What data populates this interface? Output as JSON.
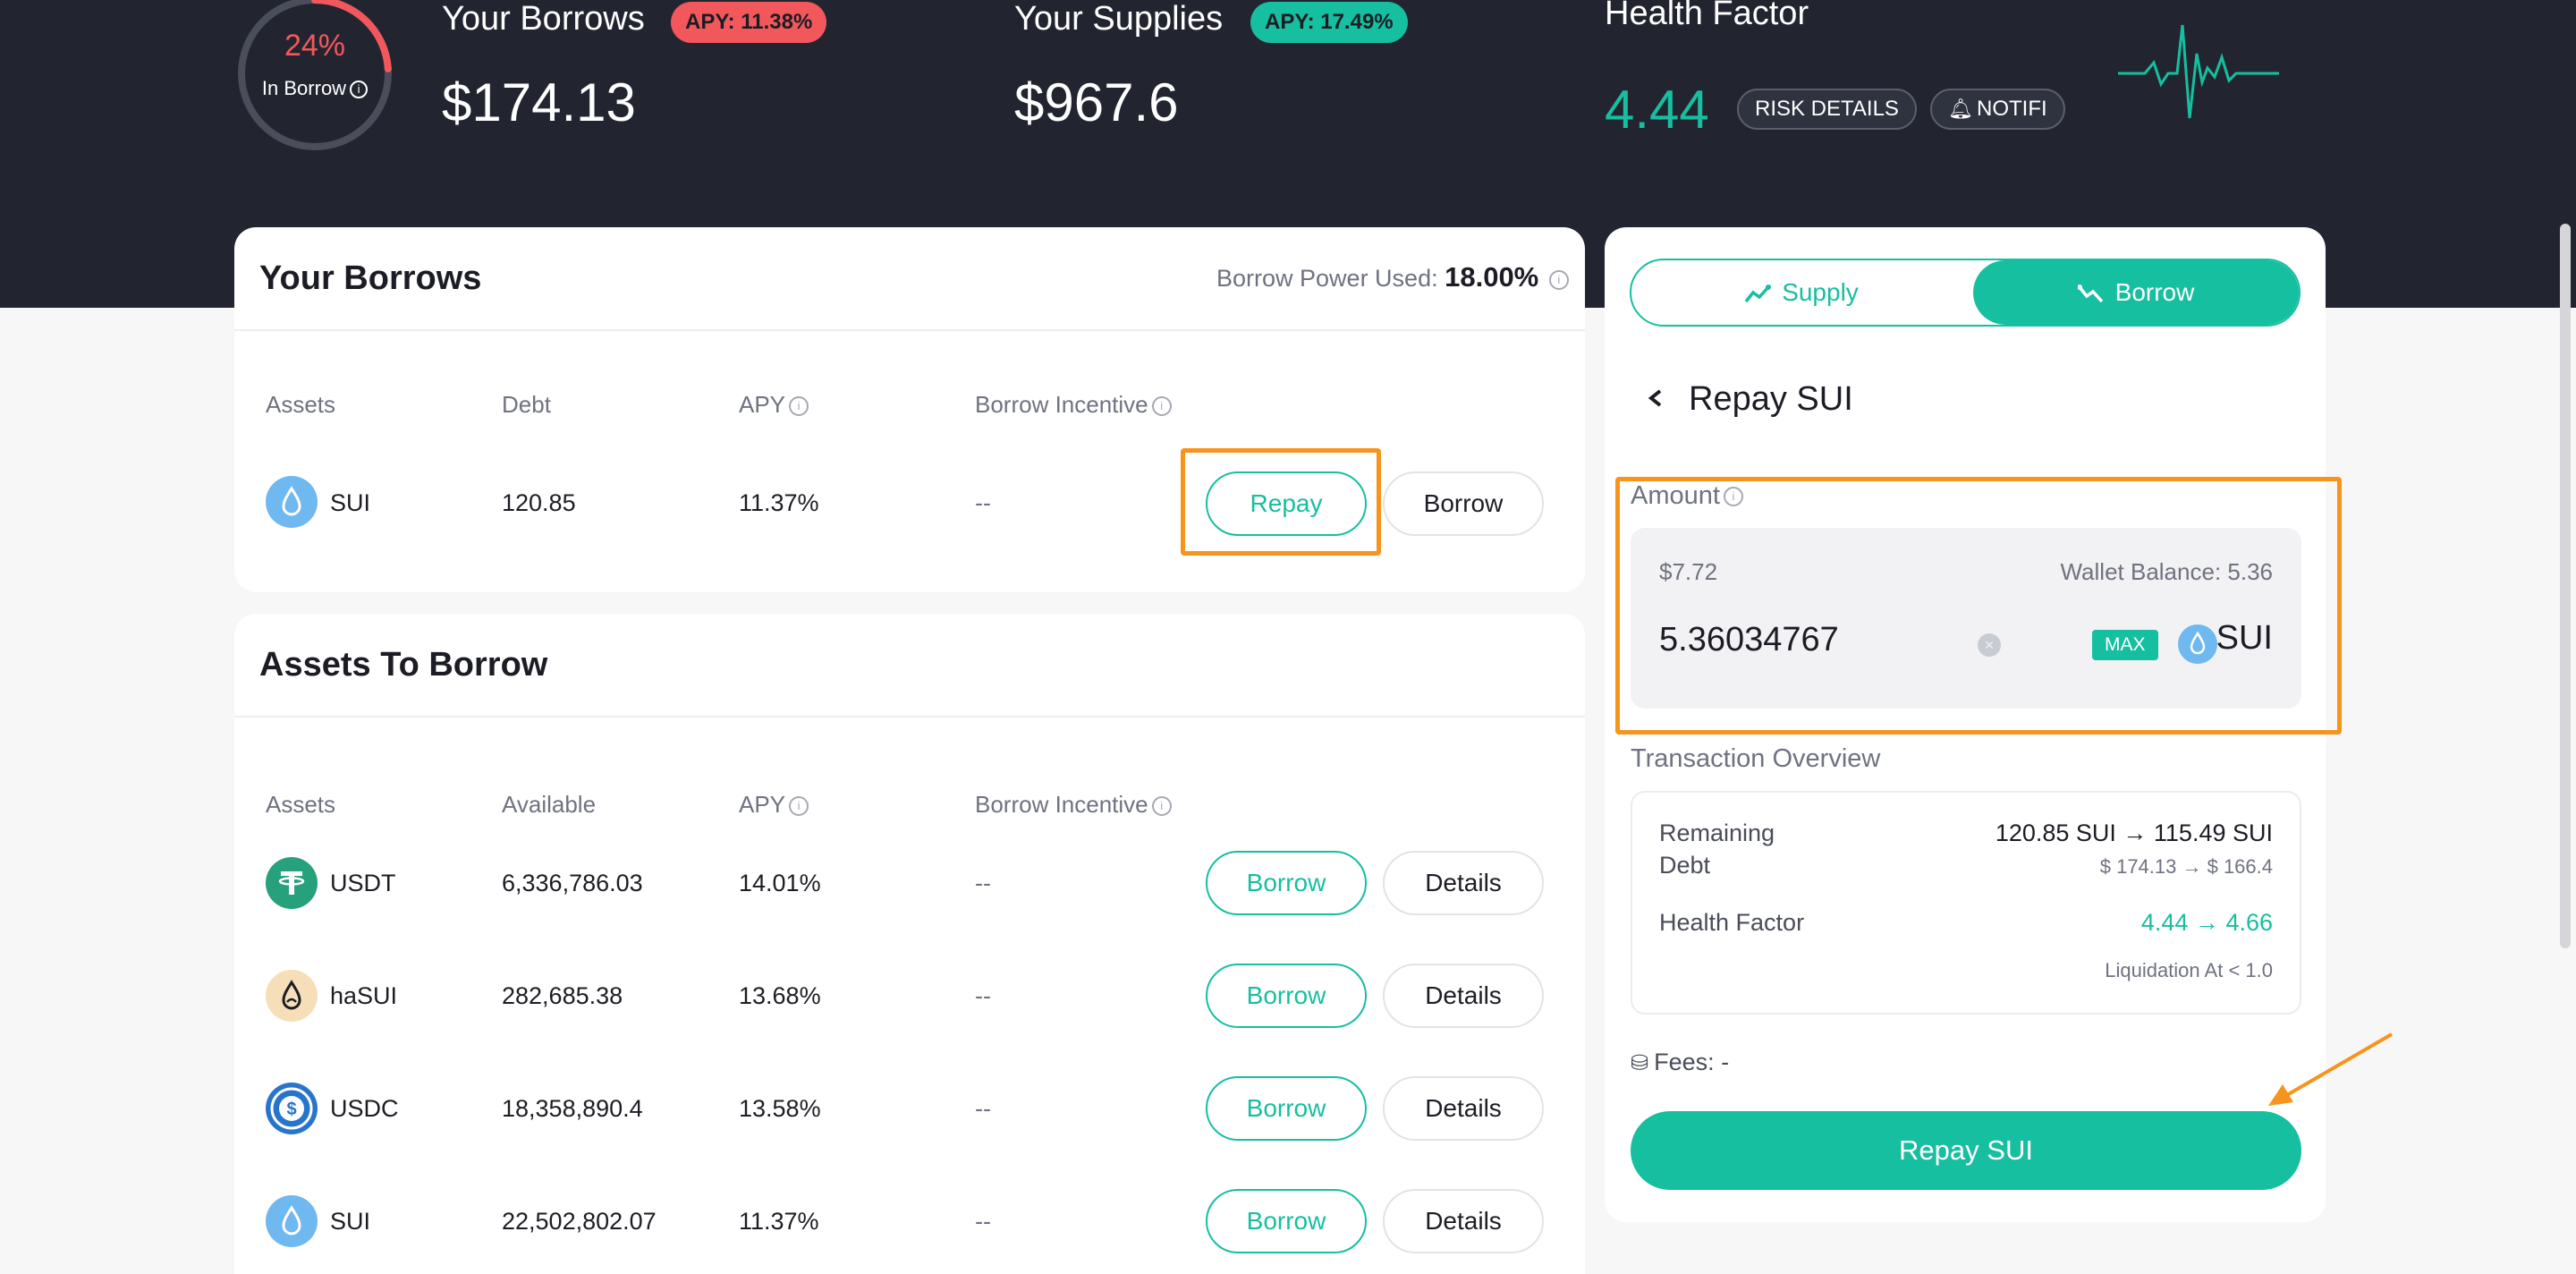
{
  "colors": {
    "teal": "#16bfa0",
    "red": "#f2585b",
    "dark": "#222530",
    "highlight": "#f7941d"
  },
  "header": {
    "ring_pct": "24%",
    "ring_fraction": 0.24,
    "ring_label": "In Borrow",
    "borrows_title": "Your Borrows",
    "borrows_apy": "APY: 11.38%",
    "borrows_value": "$174.13",
    "supplies_title": "Your Supplies",
    "supplies_apy": "APY: 17.49%",
    "supplies_value": "$967.6",
    "health_title": "Health Factor",
    "health_value": "4.44",
    "risk_details": "RISK DETAILS",
    "notifi": "NOTIFI"
  },
  "your_borrows": {
    "title": "Your Borrows",
    "power_label": "Borrow Power Used:",
    "power_value": "18.00%",
    "columns": {
      "assets": "Assets",
      "debt": "Debt",
      "apy": "APY",
      "incentive": "Borrow Incentive"
    },
    "rows": [
      {
        "asset": "SUI",
        "debt": "120.85",
        "apy": "11.37%",
        "incentive": "--",
        "repay": "Repay",
        "borrow": "Borrow"
      }
    ]
  },
  "assets_to_borrow": {
    "title": "Assets To Borrow",
    "columns": {
      "assets": "Assets",
      "available": "Available",
      "apy": "APY",
      "incentive": "Borrow Incentive"
    },
    "rows": [
      {
        "asset": "USDT",
        "available": "6,336,786.03",
        "apy": "14.01%",
        "incentive": "--",
        "borrow": "Borrow",
        "details": "Details"
      },
      {
        "asset": "haSUI",
        "available": "282,685.38",
        "apy": "13.68%",
        "incentive": "--",
        "borrow": "Borrow",
        "details": "Details"
      },
      {
        "asset": "USDC",
        "available": "18,358,890.4",
        "apy": "13.58%",
        "incentive": "--",
        "borrow": "Borrow",
        "details": "Details"
      },
      {
        "asset": "SUI",
        "available": "22,502,802.07",
        "apy": "11.37%",
        "incentive": "--",
        "borrow": "Borrow",
        "details": "Details"
      }
    ]
  },
  "panel": {
    "tab_supply": "Supply",
    "tab_borrow": "Borrow",
    "back_icon": "chevron-left-icon",
    "title": "Repay SUI",
    "amount_label": "Amount",
    "amount_usd": "$7.72",
    "wallet_balance": "Wallet Balance: 5.36",
    "amount_value": "5.36034767",
    "max": "MAX",
    "token": "SUI",
    "tx_title": "Transaction Overview",
    "remaining_label_1": "Remaining",
    "remaining_label_2": "Debt",
    "remaining_value": "120.85 SUI → 115.49 SUI",
    "remaining_usd": "$ 174.13 → $ 166.4",
    "hf_label": "Health Factor",
    "hf_value": "4.44 → 4.66",
    "liquidation": "Liquidation At < 1.0",
    "fees": "Fees: -",
    "repay_button": "Repay SUI"
  }
}
